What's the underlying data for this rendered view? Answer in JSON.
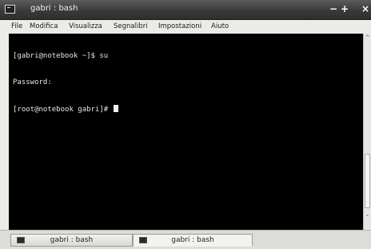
{
  "window": {
    "title": "gabri : bash",
    "minimize_symbol": "−",
    "maximize_symbol": "+",
    "close_symbol": "×"
  },
  "menubar": {
    "items": [
      {
        "label": "File"
      },
      {
        "label": "Modifica"
      },
      {
        "label": "Visualizza"
      },
      {
        "label": "Segnalibri"
      },
      {
        "label": "Impostazioni"
      },
      {
        "label": "Aiuto"
      }
    ]
  },
  "terminal": {
    "lines": [
      "[gabri@notebook ~]$ su",
      "Password:",
      "[root@notebook gabri]# "
    ]
  },
  "scrollbar": {
    "up_arrow": "^",
    "down_arrow": "⌃"
  },
  "tabs": [
    {
      "label": "gabri : bash"
    },
    {
      "label": "gabri : bash"
    }
  ],
  "icons": {
    "window_icon": "terminal-icon",
    "tab_icon": "terminal-icon"
  }
}
